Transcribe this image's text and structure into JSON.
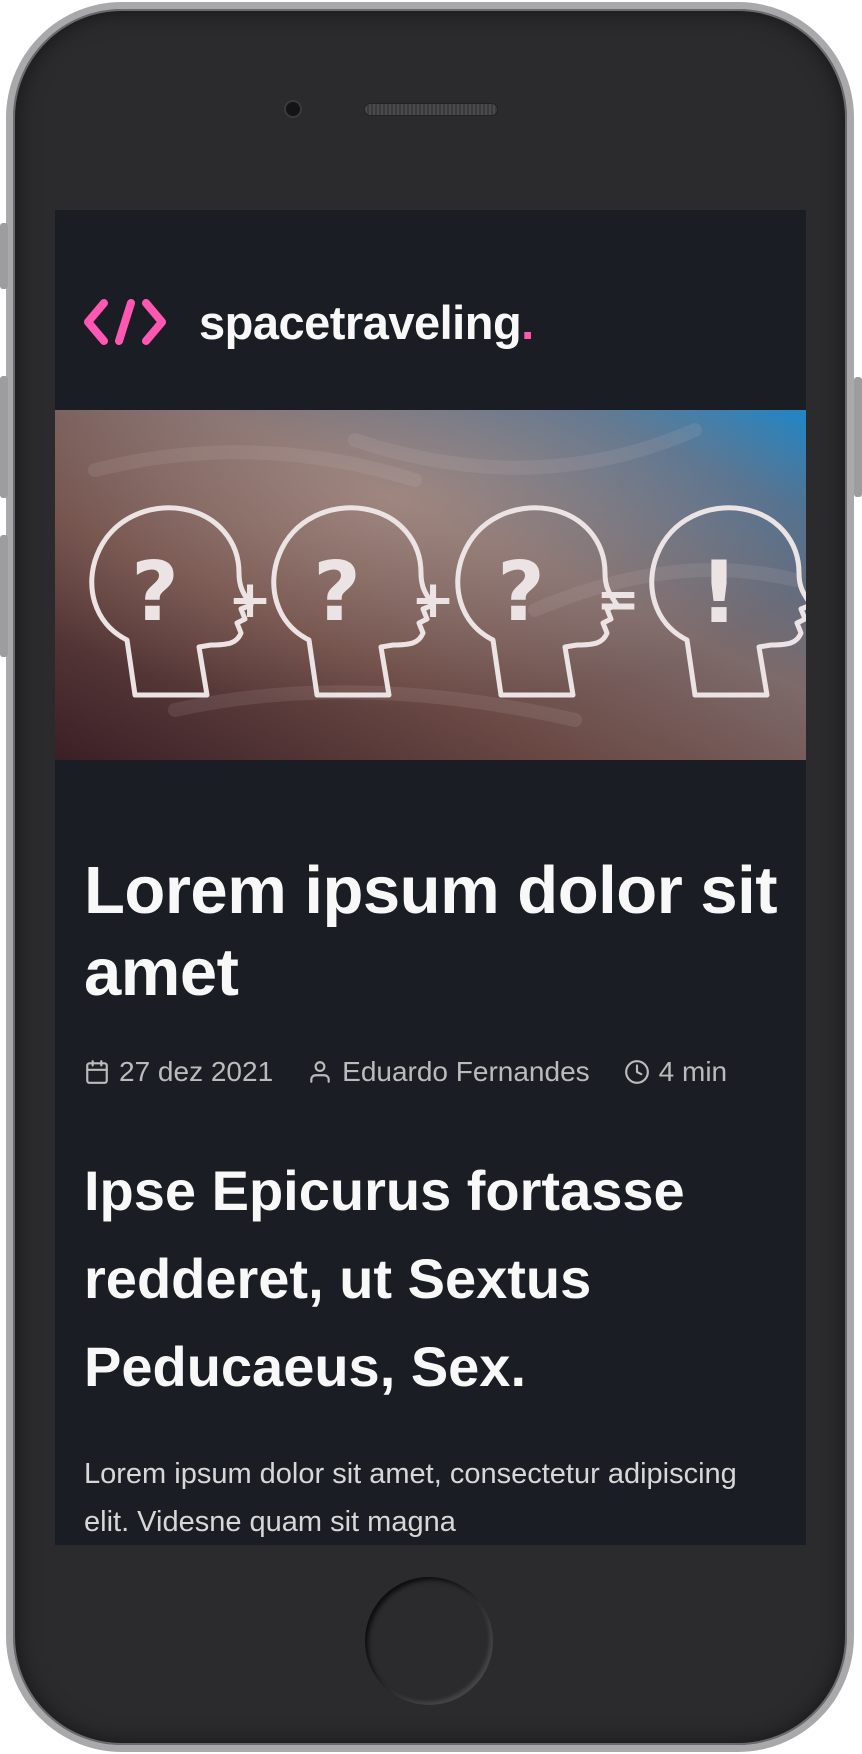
{
  "header": {
    "logo_icon": "code-brackets-icon",
    "brand_name": "spacetraveling",
    "brand_dot": "."
  },
  "banner": {
    "description_icon": "heads-question-exclamation-illustration"
  },
  "post": {
    "title": "Lorem ipsum dolor sit amet",
    "meta": {
      "date_icon": "calendar-icon",
      "date": "27 dez 2021",
      "author_icon": "user-icon",
      "author": "Eduardo Fernandes",
      "reading_icon": "clock-icon",
      "reading_time": "4 min"
    },
    "section_heading": "Ipse Epicurus fortasse redderet, ut Sextus Peducaeus, Sex.",
    "paragraph": "Lorem ipsum dolor sit amet, consectetur adipiscing elit. Videsne quam sit magna"
  },
  "colors": {
    "accent": "#ff57b2",
    "background": "#1a1d23",
    "heading": "#f8f8f8",
    "meta_text": "#bbbbbb",
    "body_text": "#d7d7d7"
  }
}
